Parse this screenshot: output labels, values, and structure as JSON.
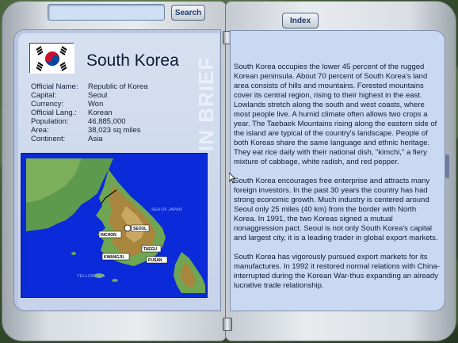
{
  "toolbar": {
    "search_value": "",
    "search_label": "Search",
    "index_label": "Index"
  },
  "country": {
    "name": "South Korea",
    "sidebar_text": "IN BRIEF",
    "flag_icon": "south-korea-flag-icon",
    "facts": [
      {
        "label": "Official Name:",
        "value": "Republic of Korea"
      },
      {
        "label": "Capital:",
        "value": "Seoul"
      },
      {
        "label": "Currency:",
        "value": "Won"
      },
      {
        "label": "Official Lang.:",
        "value": "Korean"
      },
      {
        "label": "Population:",
        "value": "46,885,000"
      },
      {
        "label": "Area:",
        "value": "38,023 sq miles"
      },
      {
        "label": "Continent:",
        "value": "Asia"
      }
    ]
  },
  "map": {
    "labels": {
      "sea_of_japan": "SEA OF JAPAN",
      "yellow_sea": "YELLOW SEA",
      "seoul": "SEOUL",
      "inchon": "INCHON",
      "taegu": "TAEGU",
      "kwangju": "KWANGJU",
      "pusan": "PUSAN"
    }
  },
  "article": {
    "paragraphs": [
      "South Korea occupies the lower 45 percent of the rugged Korean peninsula. About 70 percent of South Korea's land area consists of hills and mountains. Forested mountains cover its central region, rising to their highest in the east. Lowlands stretch along the south and west coasts, where most people live. A humid climate often allows two crops a year. The Taebaek Mountains rising along the eastern side of the island are typical of the country's landscape. People of both Koreas share the same language and ethnic heritage. They eat rice daily with their national dish, \"kimchi,\" a fiery mixture of cabbage, white radish, and red pepper.",
      "South Korea encourages free enterprise and attracts many foreign investors. In the past 30 years the country has had strong economic growth. Much industry is centered around Seoul only 25 miles (40 km) from the border with North Korea. In 1991, the two Koreas signed a mutual nonaggression pact. Seoul is not only South Korea's capital and largest city, it is a leading trader in global export markets.",
      "South Korea has vigorously pursued export markets for its manufactures. In 1992 it restored normal relations with China-interrupted during the Korean War-thus expanding an already lucrative trade relationship."
    ]
  }
}
